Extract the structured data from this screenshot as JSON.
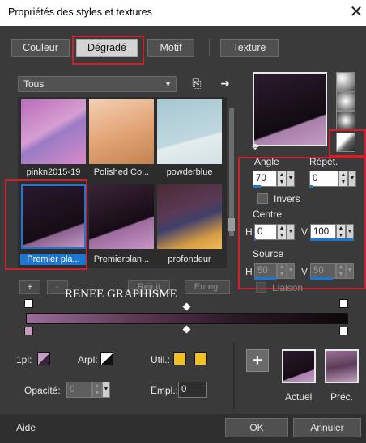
{
  "window": {
    "title": "Propriétés des styles et textures",
    "close_glyph": "✕"
  },
  "tabs": [
    {
      "label": "Couleur",
      "active": false
    },
    {
      "label": "Dégradé",
      "active": true
    },
    {
      "label": "Motif",
      "active": false
    },
    {
      "label": "Texture",
      "active": false
    }
  ],
  "category": {
    "selected": "Tous"
  },
  "toolbar": {
    "copy_icon": "copy-icon",
    "arrow_icon": "arrow-right-icon",
    "copy_glyph": "⎘",
    "arrow_glyph": "➜"
  },
  "gallery": {
    "items": [
      {
        "label": "pinkn2015-19",
        "selected": false
      },
      {
        "label": "Polished Co...",
        "selected": false
      },
      {
        "label": "powderblue",
        "selected": false
      },
      {
        "label": "Premier pla...",
        "selected": true
      },
      {
        "label": "Premierplan...",
        "selected": false
      },
      {
        "label": "profondeur",
        "selected": false
      }
    ]
  },
  "gradient": {
    "angle_label": "Angle",
    "angle": "70",
    "repeat_label": "Répét.",
    "repeat": "0",
    "invert_label": "Invers",
    "center_label": "Centre",
    "h_label": "H",
    "v_label": "V",
    "center_h": "0",
    "center_v": "100",
    "source_label": "Source",
    "source_h": "50",
    "source_v": "50",
    "link_label": "Liaison"
  },
  "buttons": {
    "add": "+",
    "remove": "-",
    "reset": "Réinit",
    "save": "Enreg."
  },
  "watermark": "RENEE GRAPHISME",
  "bottom": {
    "fg_label": "1pl:",
    "bg_label": "Arpl:",
    "use_label": "Util.:",
    "opacity_label": "Opacité:",
    "opacity": "0",
    "location_label": "Empl.:",
    "location": "0",
    "plus": "+",
    "current_label": "Actuel",
    "previous_label": "Préc."
  },
  "footer": {
    "help": "Aide",
    "ok": "OK",
    "cancel": "Annuler"
  },
  "colors": {
    "accent": "#1b77d1",
    "highlight": "#d21f2d",
    "gradient_light": "#b987b5",
    "gradient_dark": "#0f0a0c",
    "use_color": "#f0c020"
  }
}
